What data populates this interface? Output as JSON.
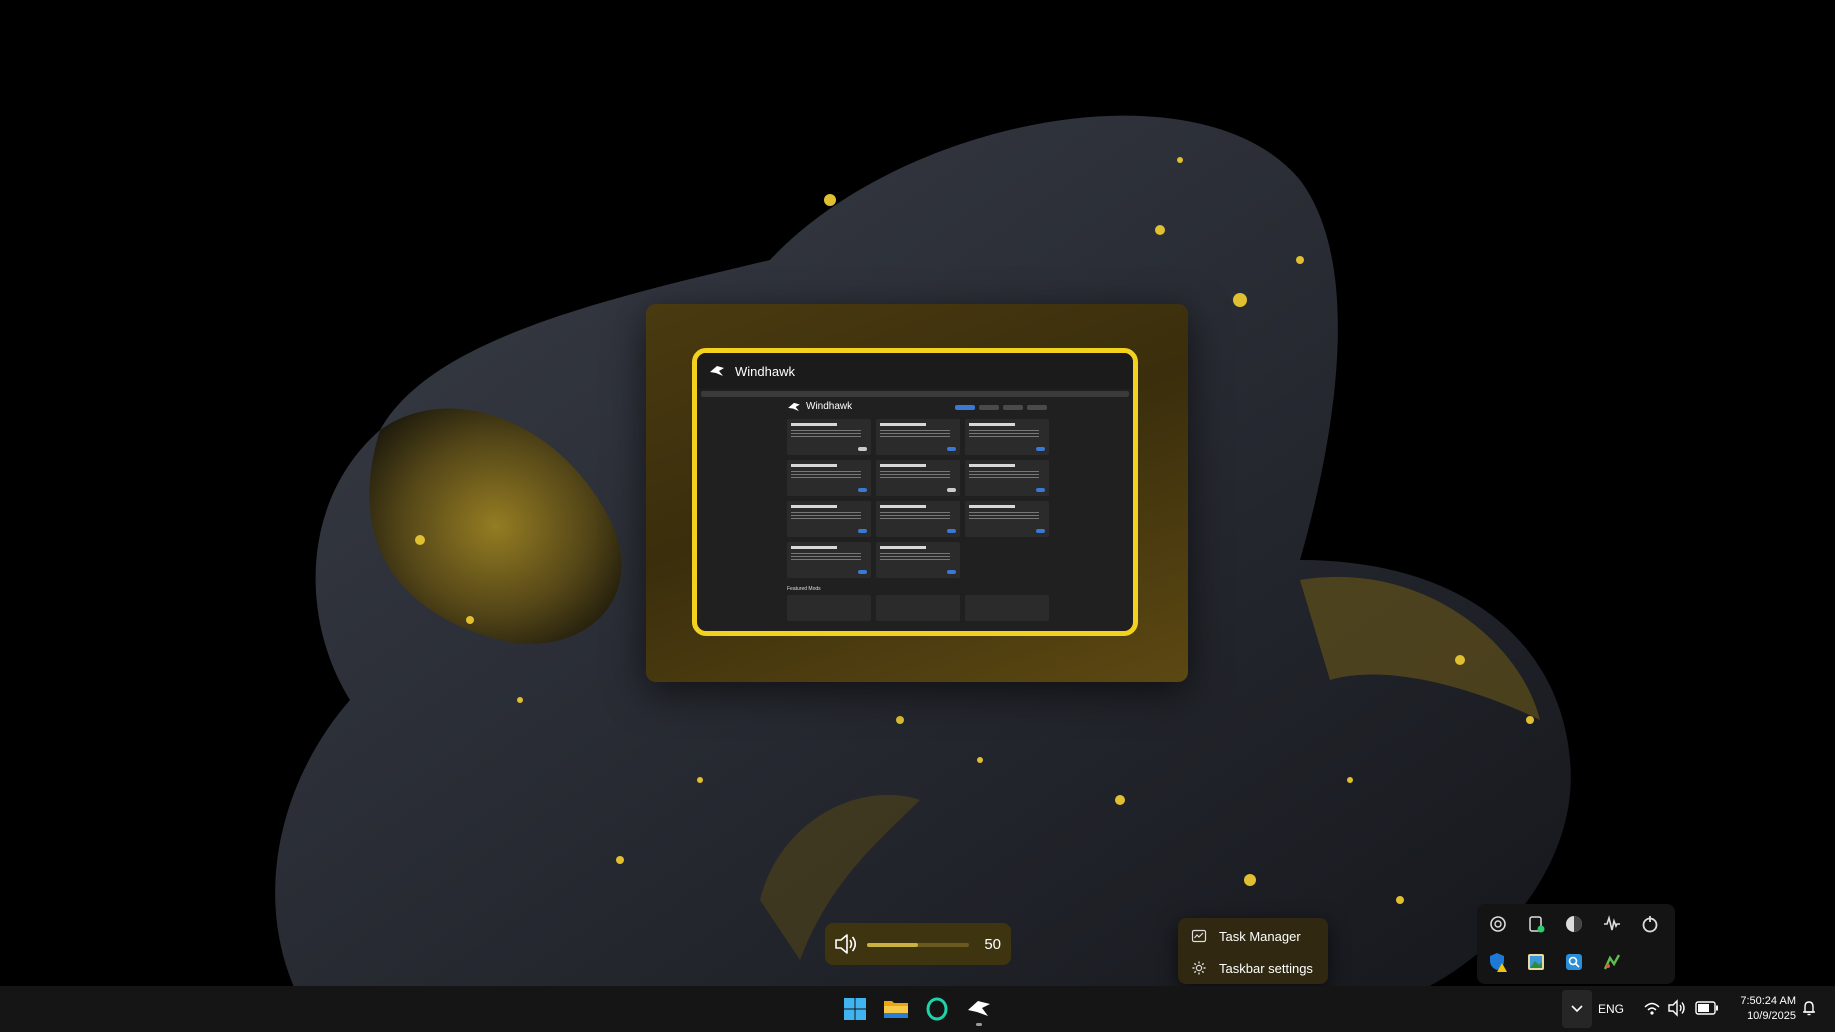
{
  "window_preview": {
    "title": "Windhawk",
    "inner_app_title": "Windhawk",
    "featured_label": "Featured Mods"
  },
  "volume": {
    "value": "50",
    "level_fraction": 0.5
  },
  "context_menu": {
    "items": [
      {
        "label": "Task Manager",
        "icon": "task-manager-icon"
      },
      {
        "label": "Taskbar settings",
        "icon": "gear-icon"
      }
    ]
  },
  "tray_overflow": {
    "icons": [
      "chatgpt-icon",
      "clipboard-status-icon",
      "globe-shield-icon",
      "audio-wave-icon",
      "refresh-circle-icon",
      "defender-warning-icon",
      "photo-app-icon",
      "search-box-icon",
      "green-app-icon"
    ]
  },
  "taskbar": {
    "apps": [
      "windows-start-icon",
      "file-explorer-icon",
      "opera-gx-icon",
      "windhawk-icon"
    ],
    "language": "ENG",
    "time": "7:50:24 AM",
    "date": "10/9/2025"
  },
  "colors": {
    "accent": "#f2d21f",
    "taskbar": "#151515",
    "menu_bg": "#302810"
  }
}
